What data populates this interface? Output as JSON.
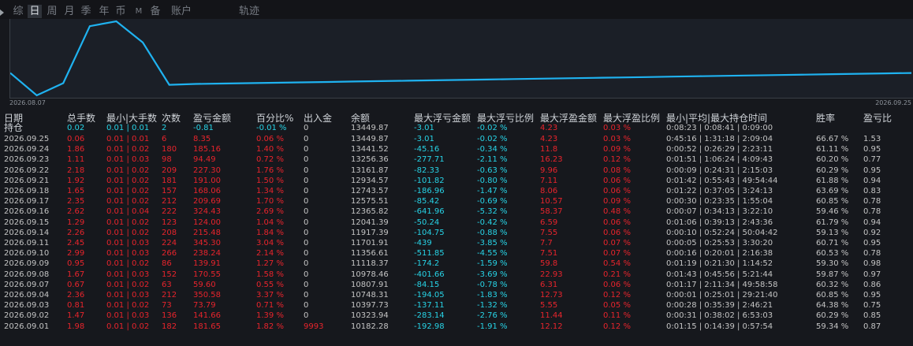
{
  "tabs": [
    {
      "label": "综",
      "active": false
    },
    {
      "label": "日",
      "active": true
    },
    {
      "label": "周",
      "active": false
    },
    {
      "label": "月",
      "active": false
    },
    {
      "label": "季",
      "active": false
    },
    {
      "label": "年",
      "active": false
    },
    {
      "label": "币",
      "active": false
    },
    {
      "label": "M",
      "active": false
    },
    {
      "label": "备",
      "active": false
    },
    {
      "label": "账户",
      "active": false
    },
    {
      "label": "轨迹",
      "active": false
    }
  ],
  "chart": {
    "start_date": "2026.08.07",
    "end_date": "2026.09.25",
    "line_color": "#1fb2f0",
    "values": [
      13449.87,
      12900,
      13200,
      14600,
      14720,
      14200,
      13160,
      13180,
      13190,
      13200,
      13210,
      13220,
      13230,
      13240,
      13250,
      13260,
      13270,
      13280,
      13290,
      13300,
      13310,
      13320,
      13330,
      13340,
      13350,
      13360,
      13370,
      13380,
      13390,
      13400,
      13410,
      13420,
      13430,
      13440,
      13450
    ]
  },
  "columns": [
    "日期",
    "总手数",
    "最小|大手数",
    "次数",
    "盈亏金额",
    "百分比%",
    "出入金",
    "余额",
    "最大浮亏金额",
    "最大浮亏比例",
    "最大浮盈金额",
    "最大浮盈比例",
    "最小|平均|最大持仓时间",
    "胜率",
    "盈亏比"
  ],
  "holding": {
    "label": "持仓",
    "lots": "0.02",
    "minmax": "0.01 | 0.01",
    "count": "2",
    "pnl": "-0.81",
    "pct": "-0.01 %",
    "deposit": "0",
    "balance": "13449.87",
    "max_loss": "-3.01",
    "max_loss_pct": "-0.02 %",
    "max_gain": "4.23",
    "max_gain_pct": "0.03 %",
    "hold_time": "0:08:23 | 0:08:41 | 0:09:00",
    "winrate": "",
    "pl_ratio": ""
  },
  "rows": [
    {
      "date": "2026.09.25",
      "lots": "0.06",
      "minmax": "0.01 | 0.01",
      "count": "6",
      "pnl": "8.35",
      "pct": "0.06 %",
      "deposit": "0",
      "balance": "13449.87",
      "max_loss": "-3.01",
      "max_loss_pct": "-0.02 %",
      "max_gain": "4.23",
      "max_gain_pct": "0.03 %",
      "hold_time": "0:45:16 | 1:31:18 | 2:09:04",
      "winrate": "66.67 %",
      "pl_ratio": "1.53"
    },
    {
      "date": "2026.09.24",
      "lots": "1.86",
      "minmax": "0.01 | 0.02",
      "count": "180",
      "pnl": "185.16",
      "pct": "1.40 %",
      "deposit": "0",
      "balance": "13441.52",
      "max_loss": "-45.16",
      "max_loss_pct": "-0.34 %",
      "max_gain": "11.8",
      "max_gain_pct": "0.09 %",
      "hold_time": "0:00:52 | 0:26:29 | 2:23:11",
      "winrate": "61.11 %",
      "pl_ratio": "0.95"
    },
    {
      "date": "2026.09.23",
      "lots": "1.11",
      "minmax": "0.01 | 0.03",
      "count": "98",
      "pnl": "94.49",
      "pct": "0.72 %",
      "deposit": "0",
      "balance": "13256.36",
      "max_loss": "-277.71",
      "max_loss_pct": "-2.11 %",
      "max_gain": "16.23",
      "max_gain_pct": "0.12 %",
      "hold_time": "0:01:51 | 1:06:24 | 4:09:43",
      "winrate": "60.20 %",
      "pl_ratio": "0.77"
    },
    {
      "date": "2026.09.22",
      "lots": "2.18",
      "minmax": "0.01 | 0.02",
      "count": "209",
      "pnl": "227.30",
      "pct": "1.76 %",
      "deposit": "0",
      "balance": "13161.87",
      "max_loss": "-82.33",
      "max_loss_pct": "-0.63 %",
      "max_gain": "9.96",
      "max_gain_pct": "0.08 %",
      "hold_time": "0:00:09 | 0:24:31 | 2:15:03",
      "winrate": "60.29 %",
      "pl_ratio": "0.95"
    },
    {
      "date": "2026.09.21",
      "lots": "1.92",
      "minmax": "0.01 | 0.02",
      "count": "181",
      "pnl": "191.00",
      "pct": "1.50 %",
      "deposit": "0",
      "balance": "12934.57",
      "max_loss": "-101.82",
      "max_loss_pct": "-0.80 %",
      "max_gain": "7.11",
      "max_gain_pct": "0.06 %",
      "hold_time": "0:01:42 | 0:55:43 | 49:54:44",
      "winrate": "61.88 %",
      "pl_ratio": "0.94"
    },
    {
      "date": "2026.09.18",
      "lots": "1.65",
      "minmax": "0.01 | 0.02",
      "count": "157",
      "pnl": "168.06",
      "pct": "1.34 %",
      "deposit": "0",
      "balance": "12743.57",
      "max_loss": "-186.96",
      "max_loss_pct": "-1.47 %",
      "max_gain": "8.06",
      "max_gain_pct": "0.06 %",
      "hold_time": "0:01:22 | 0:37:05 | 3:24:13",
      "winrate": "63.69 %",
      "pl_ratio": "0.83"
    },
    {
      "date": "2026.09.17",
      "lots": "2.35",
      "minmax": "0.01 | 0.02",
      "count": "212",
      "pnl": "209.69",
      "pct": "1.70 %",
      "deposit": "0",
      "balance": "12575.51",
      "max_loss": "-85.42",
      "max_loss_pct": "-0.69 %",
      "max_gain": "10.57",
      "max_gain_pct": "0.09 %",
      "hold_time": "0:00:30 | 0:23:35 | 1:55:04",
      "winrate": "60.85 %",
      "pl_ratio": "0.78"
    },
    {
      "date": "2026.09.16",
      "lots": "2.62",
      "minmax": "0.01 | 0.04",
      "count": "222",
      "pnl": "324.43",
      "pct": "2.69 %",
      "deposit": "0",
      "balance": "12365.82",
      "max_loss": "-641.96",
      "max_loss_pct": "-5.32 %",
      "max_gain": "58.37",
      "max_gain_pct": "0.48 %",
      "hold_time": "0:00:07 | 0:34:13 | 3:22:10",
      "winrate": "59.46 %",
      "pl_ratio": "0.78"
    },
    {
      "date": "2026.09.15",
      "lots": "1.29",
      "minmax": "0.01 | 0.02",
      "count": "123",
      "pnl": "124.00",
      "pct": "1.04 %",
      "deposit": "0",
      "balance": "12041.39",
      "max_loss": "-50.24",
      "max_loss_pct": "-0.42 %",
      "max_gain": "6.59",
      "max_gain_pct": "0.06 %",
      "hold_time": "0:01:06 | 0:39:13 | 2:43:36",
      "winrate": "61.79 %",
      "pl_ratio": "0.94"
    },
    {
      "date": "2026.09.14",
      "lots": "2.26",
      "minmax": "0.01 | 0.02",
      "count": "208",
      "pnl": "215.48",
      "pct": "1.84 %",
      "deposit": "0",
      "balance": "11917.39",
      "max_loss": "-104.75",
      "max_loss_pct": "-0.88 %",
      "max_gain": "7.55",
      "max_gain_pct": "0.06 %",
      "hold_time": "0:00:10 | 0:52:24 | 50:04:42",
      "winrate": "59.13 %",
      "pl_ratio": "0.92"
    },
    {
      "date": "2026.09.11",
      "lots": "2.45",
      "minmax": "0.01 | 0.03",
      "count": "224",
      "pnl": "345.30",
      "pct": "3.04 %",
      "deposit": "0",
      "balance": "11701.91",
      "max_loss": "-439",
      "max_loss_pct": "-3.85 %",
      "max_gain": "7.7",
      "max_gain_pct": "0.07 %",
      "hold_time": "0:00:05 | 0:25:53 | 3:30:20",
      "winrate": "60.71 %",
      "pl_ratio": "0.95"
    },
    {
      "date": "2026.09.10",
      "lots": "2.99",
      "minmax": "0.01 | 0.03",
      "count": "266",
      "pnl": "238.24",
      "pct": "2.14 %",
      "deposit": "0",
      "balance": "11356.61",
      "max_loss": "-511.85",
      "max_loss_pct": "-4.55 %",
      "max_gain": "7.51",
      "max_gain_pct": "0.07 %",
      "hold_time": "0:00:16 | 0:20:01 | 2:16:38",
      "winrate": "60.53 %",
      "pl_ratio": "0.78"
    },
    {
      "date": "2026.09.09",
      "lots": "0.95",
      "minmax": "0.01 | 0.02",
      "count": "86",
      "pnl": "139.91",
      "pct": "1.27 %",
      "deposit": "0",
      "balance": "11118.37",
      "max_loss": "-174.2",
      "max_loss_pct": "-1.59 %",
      "max_gain": "59.8",
      "max_gain_pct": "0.54 %",
      "hold_time": "0:01:19 | 0:21:30 | 1:14:52",
      "winrate": "59.30 %",
      "pl_ratio": "0.98"
    },
    {
      "date": "2026.09.08",
      "lots": "1.67",
      "minmax": "0.01 | 0.03",
      "count": "152",
      "pnl": "170.55",
      "pct": "1.58 %",
      "deposit": "0",
      "balance": "10978.46",
      "max_loss": "-401.66",
      "max_loss_pct": "-3.69 %",
      "max_gain": "22.93",
      "max_gain_pct": "0.21 %",
      "hold_time": "0:01:43 | 0:45:56 | 5:21:44",
      "winrate": "59.87 %",
      "pl_ratio": "0.97"
    },
    {
      "date": "2026.09.07",
      "lots": "0.67",
      "minmax": "0.01 | 0.02",
      "count": "63",
      "pnl": "59.60",
      "pct": "0.55 %",
      "deposit": "0",
      "balance": "10807.91",
      "max_loss": "-84.15",
      "max_loss_pct": "-0.78 %",
      "max_gain": "6.31",
      "max_gain_pct": "0.06 %",
      "hold_time": "0:01:17 | 2:11:34 | 49:58:58",
      "winrate": "60.32 %",
      "pl_ratio": "0.86"
    },
    {
      "date": "2026.09.04",
      "lots": "2.36",
      "minmax": "0.01 | 0.03",
      "count": "212",
      "pnl": "350.58",
      "pct": "3.37 %",
      "deposit": "0",
      "balance": "10748.31",
      "max_loss": "-194.05",
      "max_loss_pct": "-1.83 %",
      "max_gain": "12.73",
      "max_gain_pct": "0.12 %",
      "hold_time": "0:00:01 | 0:25:01 | 29:21:40",
      "winrate": "60.85 %",
      "pl_ratio": "0.95"
    },
    {
      "date": "2026.09.03",
      "lots": "0.81",
      "minmax": "0.01 | 0.02",
      "count": "73",
      "pnl": "73.79",
      "pct": "0.71 %",
      "deposit": "0",
      "balance": "10397.73",
      "max_loss": "-137.11",
      "max_loss_pct": "-1.32 %",
      "max_gain": "5.55",
      "max_gain_pct": "0.05 %",
      "hold_time": "0:00:28 | 0:35:39 | 2:46:21",
      "winrate": "64.38 %",
      "pl_ratio": "0.75"
    },
    {
      "date": "2026.09.02",
      "lots": "1.47",
      "minmax": "0.01 | 0.03",
      "count": "136",
      "pnl": "141.66",
      "pct": "1.39 %",
      "deposit": "0",
      "balance": "10323.94",
      "max_loss": "-283.14",
      "max_loss_pct": "-2.76 %",
      "max_gain": "11.44",
      "max_gain_pct": "0.11 %",
      "hold_time": "0:00:31 | 0:38:02 | 6:53:03",
      "winrate": "60.29 %",
      "pl_ratio": "0.85"
    },
    {
      "date": "2026.09.01",
      "lots": "1.98",
      "minmax": "0.01 | 0.02",
      "count": "182",
      "pnl": "181.65",
      "pct": "1.82 %",
      "deposit": "9993",
      "balance": "10182.28",
      "max_loss": "-192.98",
      "max_loss_pct": "-1.91 %",
      "max_gain": "12.12",
      "max_gain_pct": "0.12 %",
      "hold_time": "0:01:15 | 0:14:39 | 0:57:54",
      "winrate": "59.34 %",
      "pl_ratio": "0.87"
    }
  ]
}
